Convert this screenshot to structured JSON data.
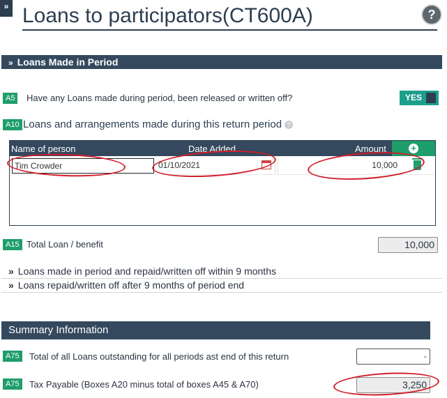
{
  "header": {
    "toggle_glyph": "»",
    "title": "Loans to participators(CT600A)",
    "help_glyph": "?"
  },
  "section_loans": {
    "chevron": "»",
    "title": "Loans Made in Period"
  },
  "a5": {
    "code": "A5",
    "question": "Have any Loans made during period, been released or written off?",
    "toggle_label": "YES"
  },
  "a10": {
    "code": "A10",
    "title": "Loans and arrangements made during this return period",
    "info_glyph": "?"
  },
  "loan_table": {
    "columns": [
      "Name of person",
      "Date Added",
      "Amount"
    ],
    "add_glyph": "+",
    "rows": [
      {
        "name": "Tim Crowder",
        "date": "01/10/2021",
        "amount": "10,000"
      }
    ]
  },
  "a15": {
    "code": "A15",
    "label": "Total Loan / benefit",
    "value": "10,000"
  },
  "collapsed_sections": [
    {
      "chevron": "»",
      "label": "Loans made in period and repaid/written off within 9 months"
    },
    {
      "chevron": "»",
      "label": "Loans repaid/written off after 9 months of period end"
    }
  ],
  "summary": {
    "title": "Summary Information",
    "rows": [
      {
        "code": "A75",
        "label": "Total of all Loans outstanding for all periods ast end of this return",
        "value": "-"
      },
      {
        "code": "A75",
        "label": "Tax Payable (Boxes A20 minus total of boxes A45 & A70)",
        "value": "3,250"
      }
    ]
  },
  "colors": {
    "navy": "#2c3e50",
    "green": "#1e9e6b",
    "teal": "#1e9e8c",
    "annotation_red": "#d21d2a"
  }
}
